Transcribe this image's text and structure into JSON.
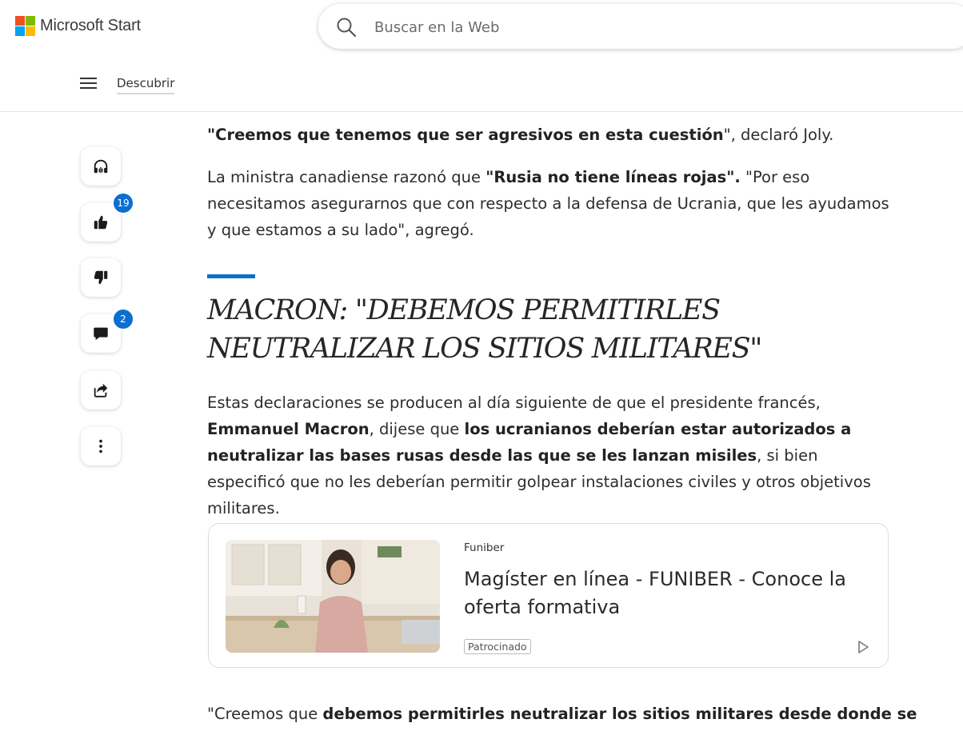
{
  "header": {
    "logo_text": "Microsoft Start",
    "logo_colors": [
      "#f25022",
      "#7fba00",
      "#00a4ef",
      "#ffb900"
    ],
    "search_placeholder": "Buscar en la Web"
  },
  "nav": {
    "discover_label": "Descubrir"
  },
  "actions": {
    "like_count": "19",
    "comment_count": "2",
    "accent_color": "#0b6fd0",
    "icons": [
      "headphones-icon",
      "thumbs-up-icon",
      "thumbs-down-icon",
      "comment-icon",
      "share-icon",
      "more-icon"
    ]
  },
  "article": {
    "p1_bold": "\"Creemos que tenemos que ser agresivos en esta cuestión",
    "p1_rest": "\", declaró Joly.",
    "p2_a": "La ministra canadiense razonó que ",
    "p2_bold": "\"Rusia no tiene líneas rojas\".",
    "p2_b": " \"Por eso necesitamos asegurarnos que con respecto a la defensa de Ucrania, que les ayudamos y que estamos a su lado\", agregó.",
    "heading": "MACRON: \"DEBEMOS PERMITIRLES NEUTRALIZAR LOS SITIOS MILITARES\"",
    "p3_a": "Estas declaraciones se producen al día siguiente de que el presidente francés, ",
    "p3_bold1": "Emmanuel Macron",
    "p3_b": ", dijese que ",
    "p3_bold2": "los ucranianos deberían estar autorizados a neutralizar las bases rusas desde las que se les lanzan misiles",
    "p3_c": ", si bien especificó que no les deberían permitir golpear instalaciones civiles y otros objetivos militares.",
    "p4_a": "\"Creemos que ",
    "p4_bold": "debemos permitirles neutralizar los sitios militares desde donde se"
  },
  "ad": {
    "source": "Funiber",
    "title": "Magíster en línea - FUNIBER - Conoce la oferta formativa",
    "sponsored_label": "Patrocinado"
  }
}
